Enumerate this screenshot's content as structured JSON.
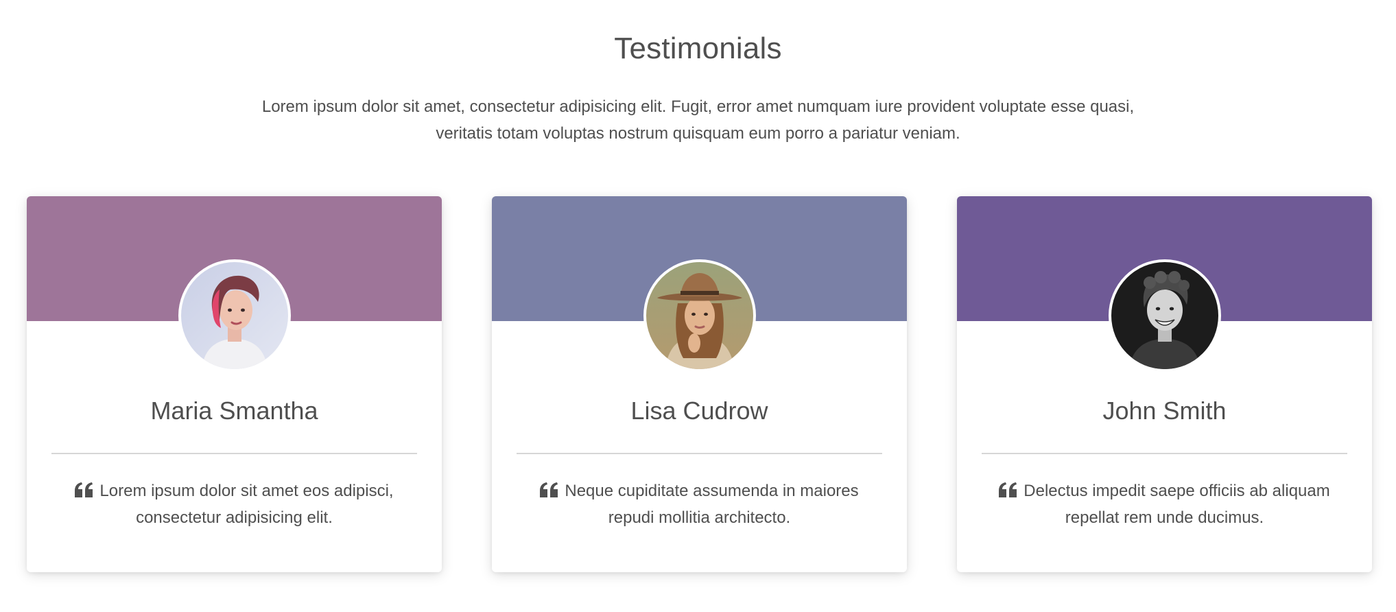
{
  "section": {
    "title": "Testimonials",
    "intro": "Lorem ipsum dolor sit amet, consectetur adipisicing elit. Fugit, error amet numquam iure provident voluptate esse quasi, veritatis totam voluptas nostrum quisquam eum porro a pariatur veniam."
  },
  "testimonials": [
    {
      "name": "Maria Smantha",
      "quote": "Lorem ipsum dolor sit amet eos adipisci, consectetur adipisicing elit.",
      "banner_color": "#9e7599",
      "avatar_icon": "avatar-woman-pink-hair"
    },
    {
      "name": "Lisa Cudrow",
      "quote": "Neque cupiditate assumenda in maiores repudi mollitia architecto.",
      "banner_color": "#7a80a6",
      "avatar_icon": "avatar-woman-hat"
    },
    {
      "name": "John Smith",
      "quote": "Delectus impedit saepe officiis ab aliquam repellat rem unde ducimus.",
      "banner_color": "#6f5a96",
      "avatar_icon": "avatar-man-monochrome"
    }
  ],
  "colors": {
    "text": "#4f4f4f",
    "divider": "#d6d6d6"
  }
}
